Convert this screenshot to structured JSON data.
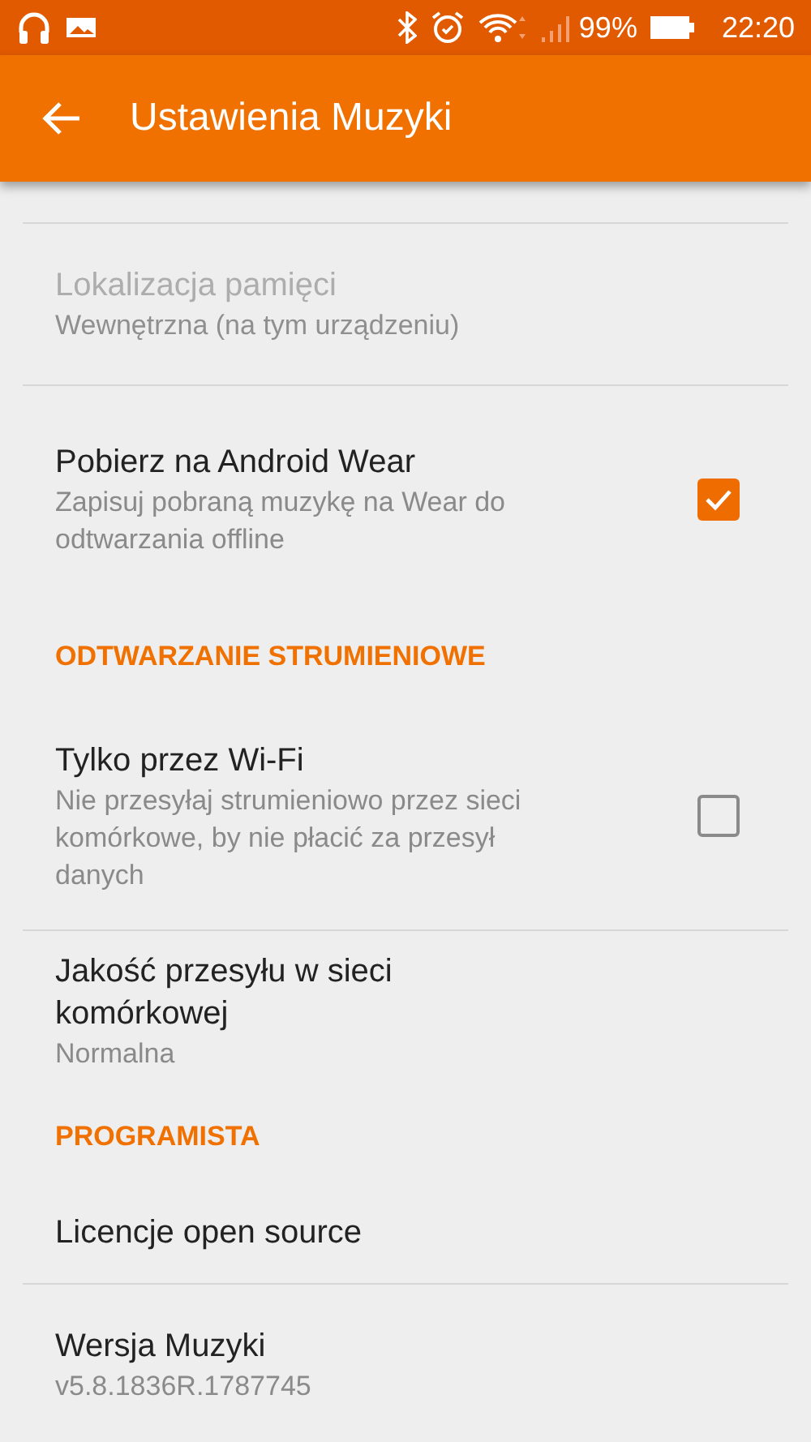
{
  "status_bar": {
    "battery": "99%",
    "time": "22:20"
  },
  "app_bar": {
    "title": "Ustawienia Muzyki"
  },
  "items": [
    {
      "kind": "pref",
      "title": "Lokalizacja pamięci",
      "summary": "Wewnętrzna (na tym urządzeniu)",
      "disabled": true
    },
    {
      "kind": "pref",
      "title": "Pobierz na Android Wear",
      "summary": "Zapisuj pobraną muzykę na Wear do odtwarzania offline",
      "disabled": false,
      "checked": true
    },
    {
      "kind": "header",
      "title": "ODTWARZANIE STRUMIENIOWE"
    },
    {
      "kind": "pref",
      "title": "Tylko przez Wi-Fi",
      "summary": "Nie przesyłaj strumieniowo przez sieci komórkowe, by nie płacić za przesył danych",
      "disabled": false,
      "checked": false
    },
    {
      "kind": "pref",
      "title": "Jakość przesyłu w sieci komórkowej",
      "summary": "Normalna",
      "disabled": false
    },
    {
      "kind": "header",
      "title": "PROGRAMISTA"
    },
    {
      "kind": "pref",
      "title": "Licencje open source",
      "disabled": false
    },
    {
      "kind": "pref",
      "title": "Wersja Muzyki",
      "summary": "v5.8.1836R.1787745",
      "disabled": false
    }
  ]
}
